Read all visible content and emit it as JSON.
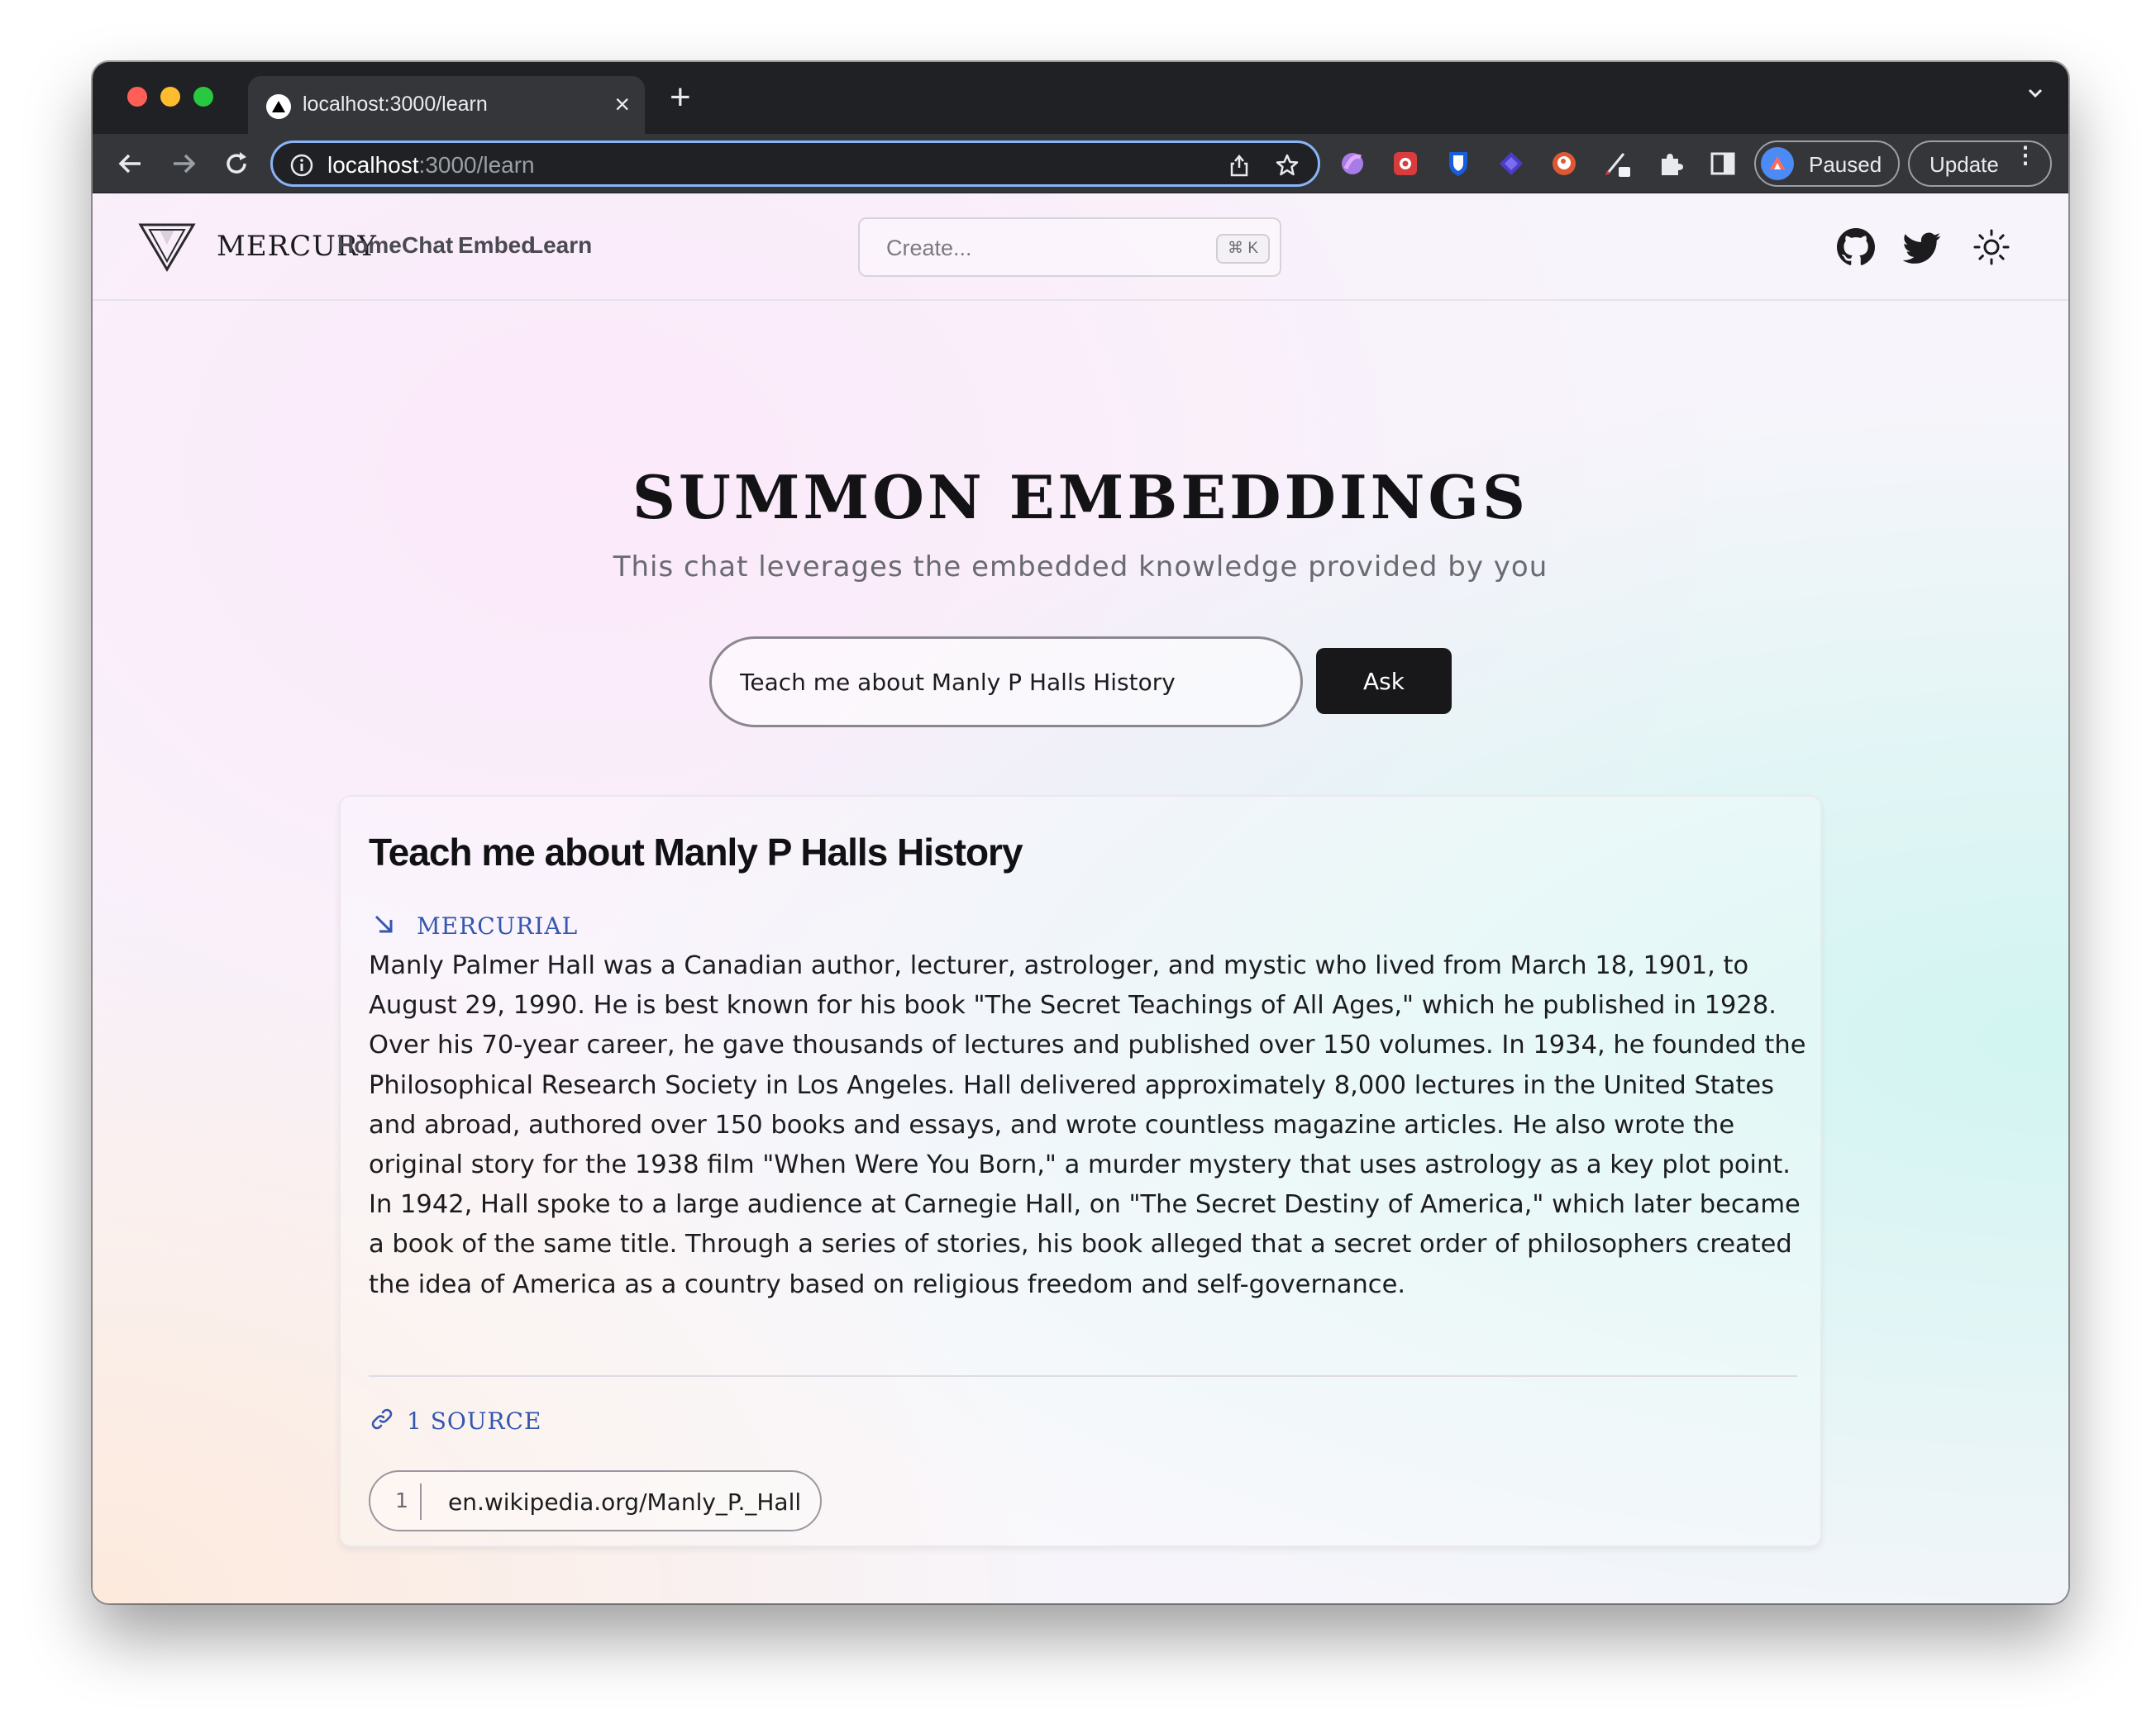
{
  "browser": {
    "tab_title": "localhost:3000/learn",
    "tab_close": "×",
    "new_tab": "+",
    "url_host": "localhost",
    "url_path": ":3000/learn",
    "profile_label": "Paused",
    "update_label": "Update",
    "update_menu": "⋮",
    "extensions": [
      "arc-extension-icon",
      "ublock-icon",
      "bitwarden-icon",
      "cube-icon",
      "duckduckgo-icon",
      "pen-icon",
      "puzzle-icon",
      "sidepanel-icon"
    ]
  },
  "nav": {
    "brand": "MERCURY",
    "links": [
      "Home",
      "Chat",
      "Embed",
      "Learn"
    ],
    "search_placeholder": "Create...",
    "search_shortcut": "⌘ K"
  },
  "hero": {
    "title": "SUMMON EMBEDDINGS",
    "subtitle": "This chat leverages the embedded knowledge provided by you",
    "input_value": "Teach me about Manly P Halls History",
    "ask_label": "Ask"
  },
  "result": {
    "question": "Teach me about Manly P Halls History",
    "answer_label": "MERCURIAL",
    "answer": "Manly Palmer Hall was a Canadian author, lecturer, astrologer, and mystic who lived from March 18, 1901, to August 29, 1990. He is best known for his book \"The Secret Teachings of All Ages,\" which he published in 1928. Over his 70-year career, he gave thousands of lectures and published over 150 volumes. In 1934, he founded the Philosophical Research Society in Los Angeles. Hall delivered approximately 8,000 lectures in the United States and abroad, authored over 150 books and essays, and wrote countless magazine articles. He also wrote the original story for the 1938 film \"When Were You Born,\" a murder mystery that uses astrology as a key plot point. In 1942, Hall spoke to a large audience at Carnegie Hall, on \"The Secret Destiny of America,\" which later became a book of the same title. Through a series of stories, his book alleged that a secret order of philosophers created the idea of America as a country based on religious freedom and self-governance.",
    "sources_label": "1 SOURCE",
    "sources": [
      {
        "index": "1",
        "url": "en.wikipedia.org/Manly_P._Hall"
      }
    ]
  },
  "colors": {
    "accent": "#3457b0",
    "button_bg": "#18181b",
    "chrome_dark": "#202124"
  }
}
